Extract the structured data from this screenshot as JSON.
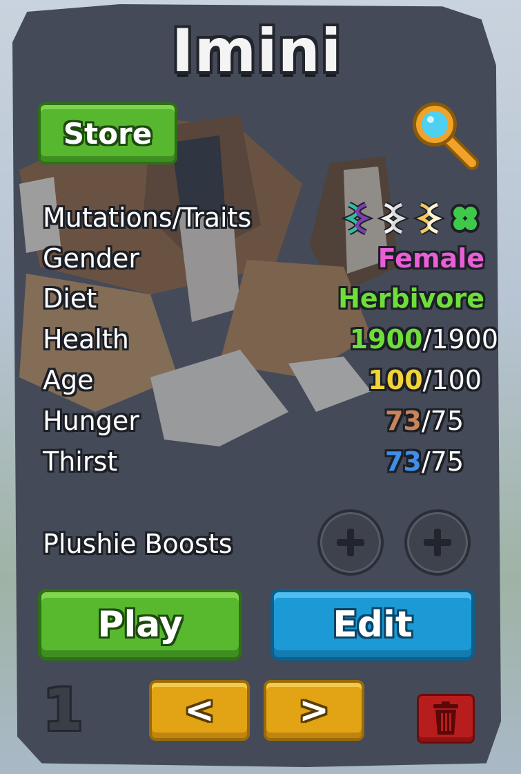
{
  "card": {
    "name": "Imini",
    "store_label": "Store",
    "stats": [
      {
        "label": "Mutations/Traits"
      },
      {
        "label": "Gender",
        "value": "Female",
        "color": "#e85fd6"
      },
      {
        "label": "Diet",
        "value": "Herbivore",
        "color": "#6fde3a"
      },
      {
        "label": "Health",
        "current": "1900",
        "max": "/1900",
        "color": "#6fde3a"
      },
      {
        "label": "Age",
        "current": "100",
        "max": "/100",
        "color": "#f2d43a"
      },
      {
        "label": "Hunger",
        "current": "73",
        "max": "/75",
        "color": "#c9845a"
      },
      {
        "label": "Thirst",
        "current": "73",
        "max": "/75",
        "color": "#3f8fe8"
      }
    ],
    "trait_icons": [
      "dna-mutation-icon",
      "dna-white-icon",
      "dna-gold-icon",
      "clover-icon"
    ],
    "plushie_label": "Plushie Boosts",
    "play_label": "Play",
    "edit_label": "Edit",
    "prev_label": "<",
    "next_label": ">",
    "slot_number": "1",
    "accent": {
      "green": "#58b92f",
      "blue": "#1c9ad6",
      "yellow": "#e2a414",
      "red": "#b81d1d"
    }
  }
}
